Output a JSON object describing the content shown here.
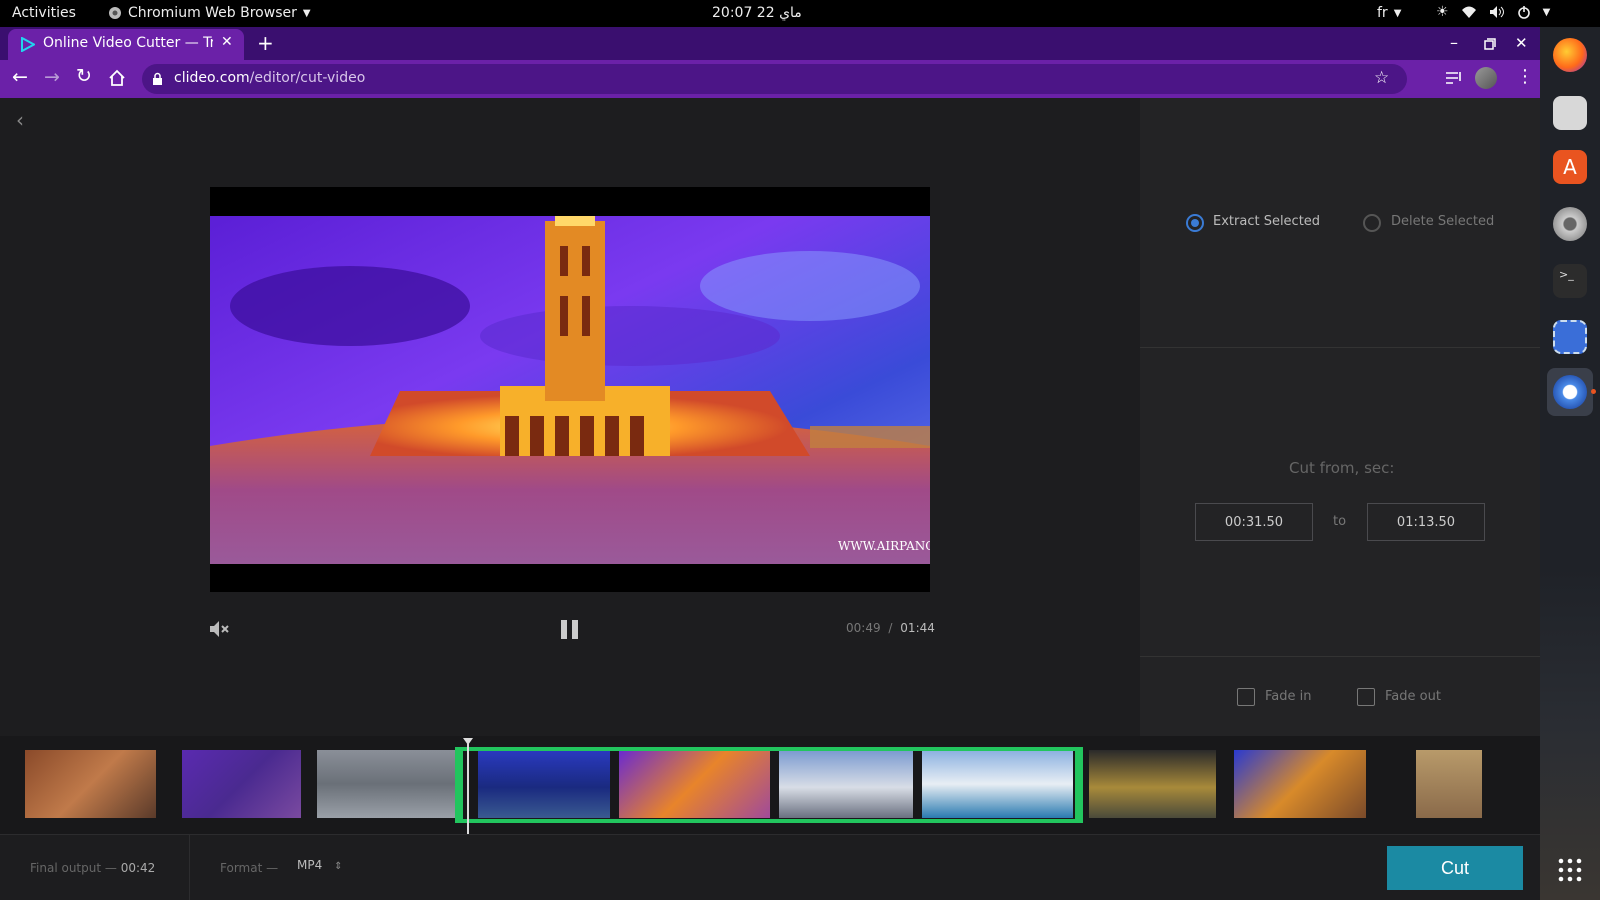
{
  "system_bar": {
    "activities": "Activities",
    "app_name": "Chromium Web Browser",
    "clock": "20:07  22 ماي",
    "lang": "fr"
  },
  "browser": {
    "tab_title": "Online Video Cutter — Tri",
    "url_domain": "clideo.com",
    "url_path": "/editor/cut-video"
  },
  "player": {
    "current_time": "00:49",
    "time_separator": "/",
    "total_time": "01:44",
    "watermark": "WWW.AIRPANO"
  },
  "panel": {
    "mode_options": [
      {
        "label": "Extract Selected",
        "selected": true
      },
      {
        "label": "Delete Selected",
        "selected": false
      }
    ],
    "cut_from_label": "Cut from, sec:",
    "from_value": "00:31.50",
    "to_label": "to",
    "to_value": "01:13.50",
    "fade_in_label": "Fade in",
    "fade_out_label": "Fade out",
    "fade_in_checked": false,
    "fade_out_checked": false
  },
  "footer": {
    "final_output_label": "Final output —",
    "final_output_value": "00:42",
    "format_label": "Format —",
    "format_value": "MP4",
    "cut_button": "Cut"
  },
  "colors": {
    "browser_purple": "#6b21a8",
    "selection_green": "#22c55e",
    "cut_button": "#1b8aa3",
    "radio_blue": "#3a7bd5"
  },
  "dock_icons": [
    "firefox-icon",
    "files-icon",
    "software-center-icon",
    "settings-icon",
    "terminal-icon",
    "screenshot-icon",
    "chromium-icon",
    "app-grid-icon"
  ]
}
